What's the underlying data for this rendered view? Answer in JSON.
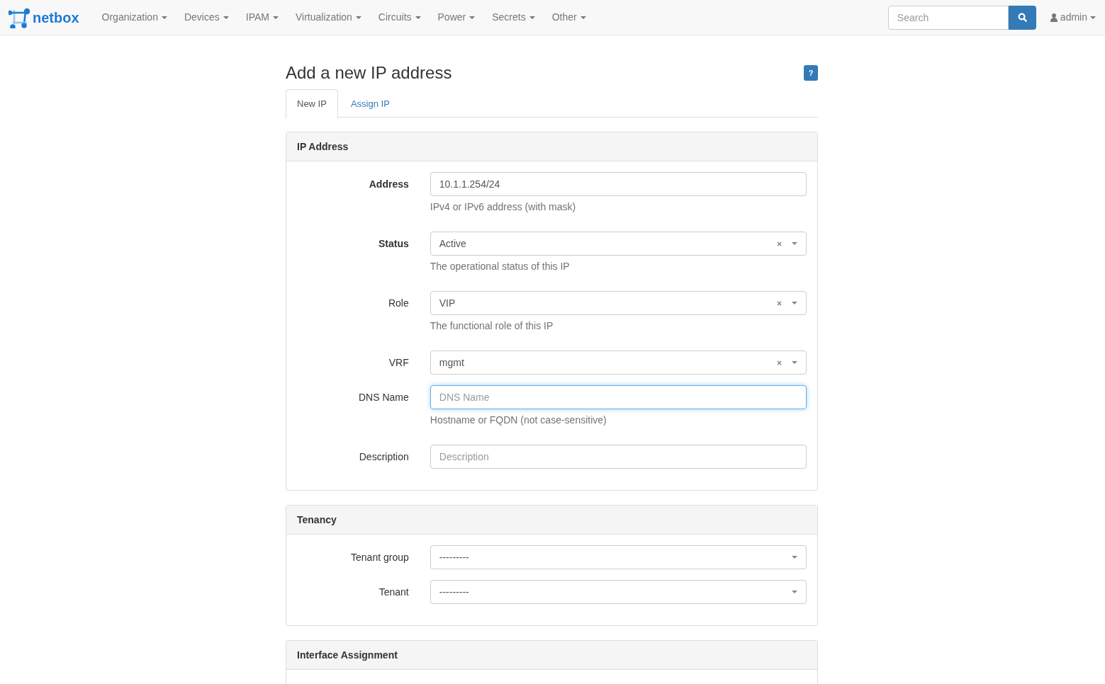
{
  "navbar": {
    "brand": "netbox",
    "menus": [
      {
        "label": "Organization"
      },
      {
        "label": "Devices"
      },
      {
        "label": "IPAM"
      },
      {
        "label": "Virtualization"
      },
      {
        "label": "Circuits"
      },
      {
        "label": "Power"
      },
      {
        "label": "Secrets"
      },
      {
        "label": "Other"
      }
    ],
    "search": {
      "placeholder": "Search"
    },
    "user": "admin"
  },
  "page": {
    "title": "Add a new IP address",
    "help": "?"
  },
  "tabs": [
    {
      "label": "New IP",
      "selected": true
    },
    {
      "label": "Assign IP",
      "selected": false
    }
  ],
  "panels": [
    {
      "heading": "IP Address",
      "fields": [
        {
          "label": "Address",
          "kind": "text",
          "required": true,
          "value": "10.1.1.254/24",
          "help": "IPv4 or IPv6 address (with mask)",
          "focused": false
        },
        {
          "label": "Status",
          "kind": "select",
          "required": true,
          "value": "Active",
          "clearable": true,
          "help": "The operational status of this IP"
        },
        {
          "label": "Role",
          "kind": "select",
          "required": false,
          "value": "VIP",
          "clearable": true,
          "help": "The functional role of this IP"
        },
        {
          "label": "VRF",
          "kind": "select",
          "required": false,
          "value": "mgmt",
          "clearable": true
        },
        {
          "label": "DNS Name",
          "kind": "text",
          "required": false,
          "placeholder": "DNS Name",
          "help": "Hostname or FQDN (not case-sensitive)",
          "focused": true
        },
        {
          "label": "Description",
          "kind": "text",
          "required": false,
          "placeholder": "Description",
          "focused": false
        }
      ]
    },
    {
      "heading": "Tenancy",
      "fields": [
        {
          "label": "Tenant group",
          "kind": "select",
          "required": false,
          "value": "---------",
          "clearable": false
        },
        {
          "label": "Tenant",
          "kind": "select",
          "required": false,
          "value": "---------",
          "clearable": false
        }
      ]
    },
    {
      "heading": "Interface Assignment"
    }
  ]
}
